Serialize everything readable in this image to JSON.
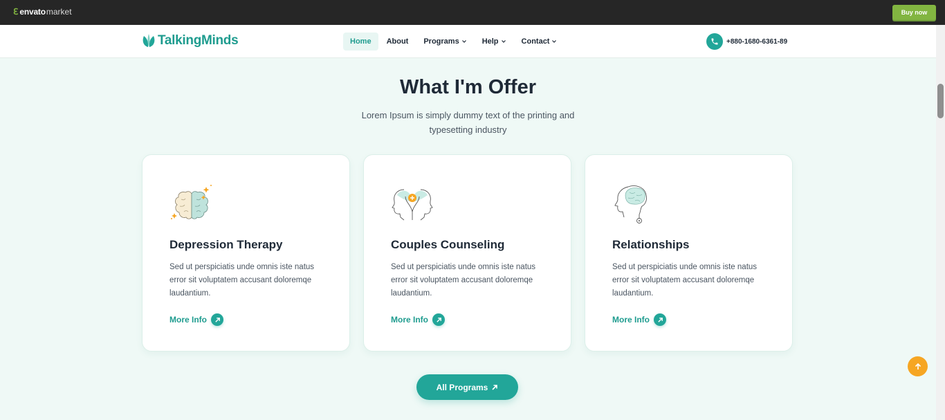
{
  "envato": {
    "brand": "envato",
    "market": "market",
    "buy_label": "Buy now",
    "accent": "#82b541"
  },
  "header": {
    "logo_text": "TalkingMinds",
    "nav": [
      {
        "label": "Home",
        "active": true
      },
      {
        "label": "About"
      },
      {
        "label": "Programs",
        "dropdown": true
      },
      {
        "label": "Help",
        "dropdown": true
      },
      {
        "label": "Contact",
        "dropdown": true
      }
    ],
    "phone": "+880-1680-6361-89"
  },
  "section": {
    "title": "What I'm Offer",
    "subtitle": "Lorem Ipsum is simply dummy text of the printing and typesetting industry"
  },
  "cards": [
    {
      "icon": "brain-sparkle-icon",
      "title": "Depression Therapy",
      "desc": "Sed ut perspiciatis unde omnis iste natus error sit voluptatem accusant doloremqe laudantium.",
      "link": "More Info"
    },
    {
      "icon": "couple-heads-icon",
      "title": "Couples Counseling",
      "desc": "Sed ut perspiciatis unde omnis iste natus error sit voluptatem accusant doloremqe laudantium.",
      "link": "More Info"
    },
    {
      "icon": "head-brain-icon",
      "title": "Relationships",
      "desc": "Sed ut perspiciatis unde omnis iste natus error sit voluptatem accusant doloremqe laudantium.",
      "link": "More Info"
    }
  ],
  "all_programs_label": "All Programs",
  "colors": {
    "primary": "#22a699",
    "background": "#eff9f6",
    "back_to_top": "#f6a623"
  }
}
